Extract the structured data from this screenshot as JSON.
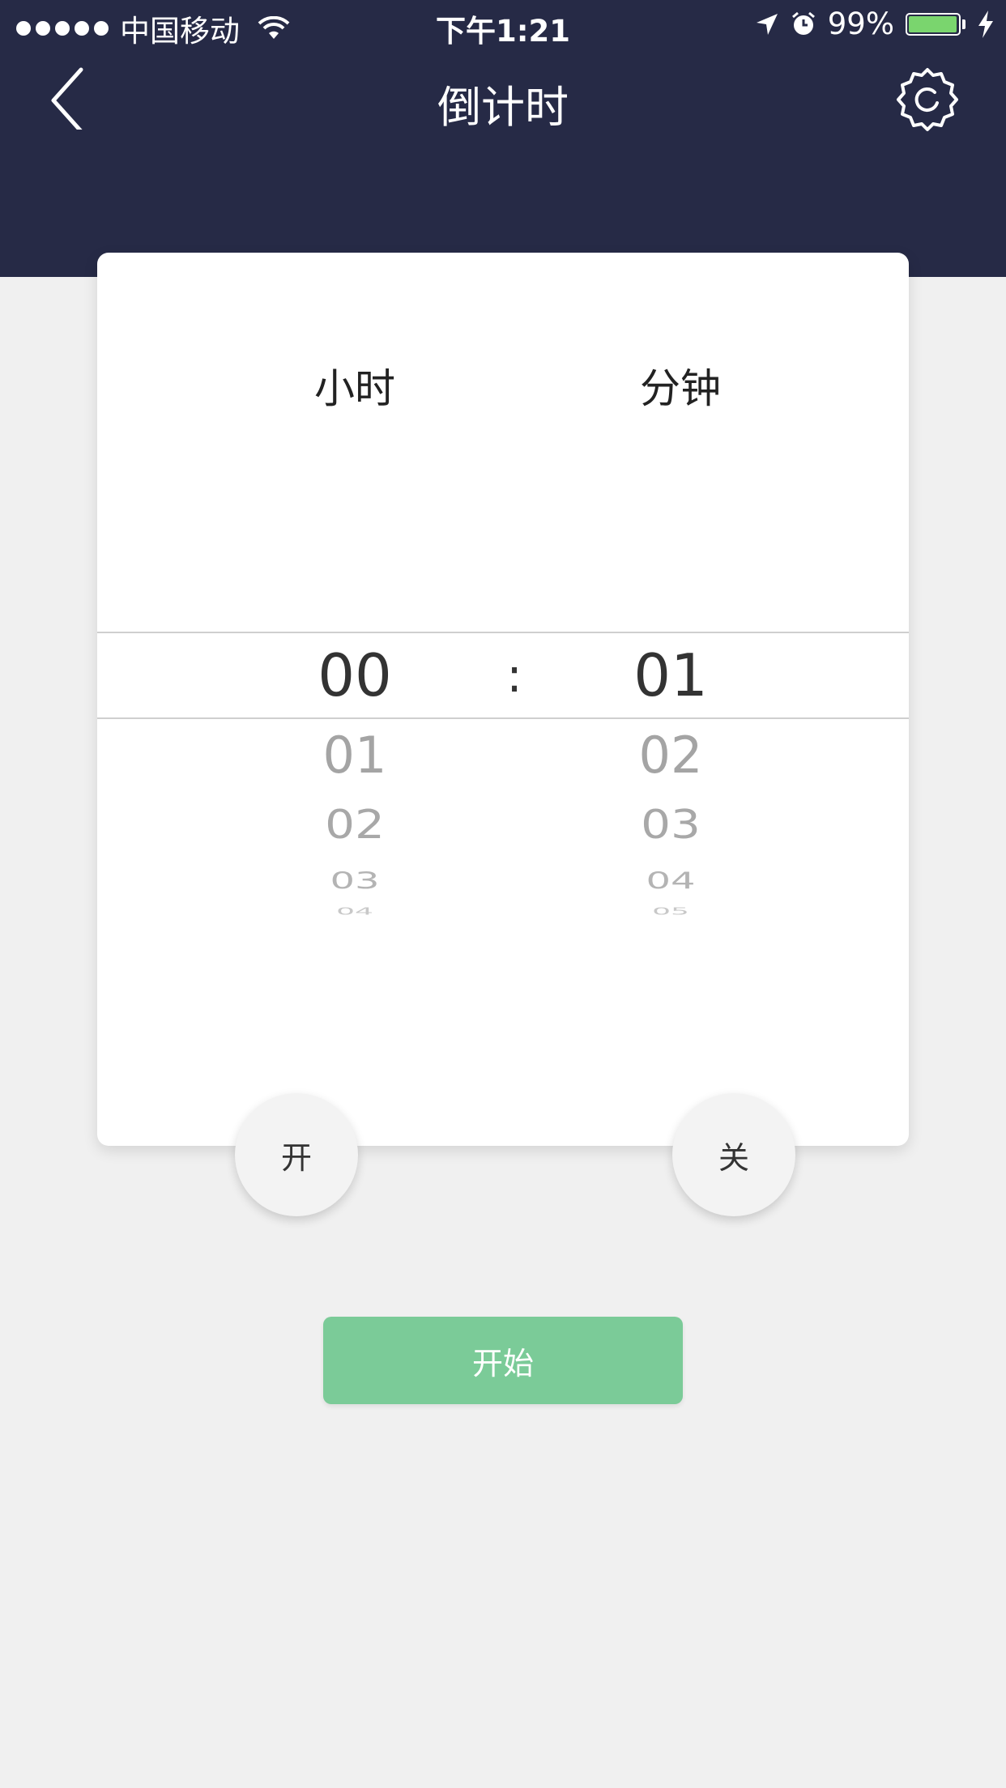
{
  "status_bar": {
    "carrier": "中国移动",
    "time": "下午1:21",
    "battery": "99%",
    "battery_level": 0.99
  },
  "nav": {
    "title": "倒计时",
    "back_icon": "chevron-left-icon",
    "settings_icon": "gear-icon"
  },
  "picker": {
    "hours_label": "小时",
    "minutes_label": "分钟",
    "separator": ":",
    "hours": {
      "selected": "00",
      "below": [
        "01",
        "02",
        "03",
        "04"
      ]
    },
    "minutes": {
      "selected": "01",
      "below": [
        "02",
        "03",
        "04",
        "05"
      ]
    }
  },
  "buttons": {
    "on": "开",
    "off": "关",
    "start": "开始"
  },
  "colors": {
    "header": "#262a46",
    "start_button": "#7bcb98",
    "battery": "#7ad56e",
    "background": "#f0f0f0"
  }
}
